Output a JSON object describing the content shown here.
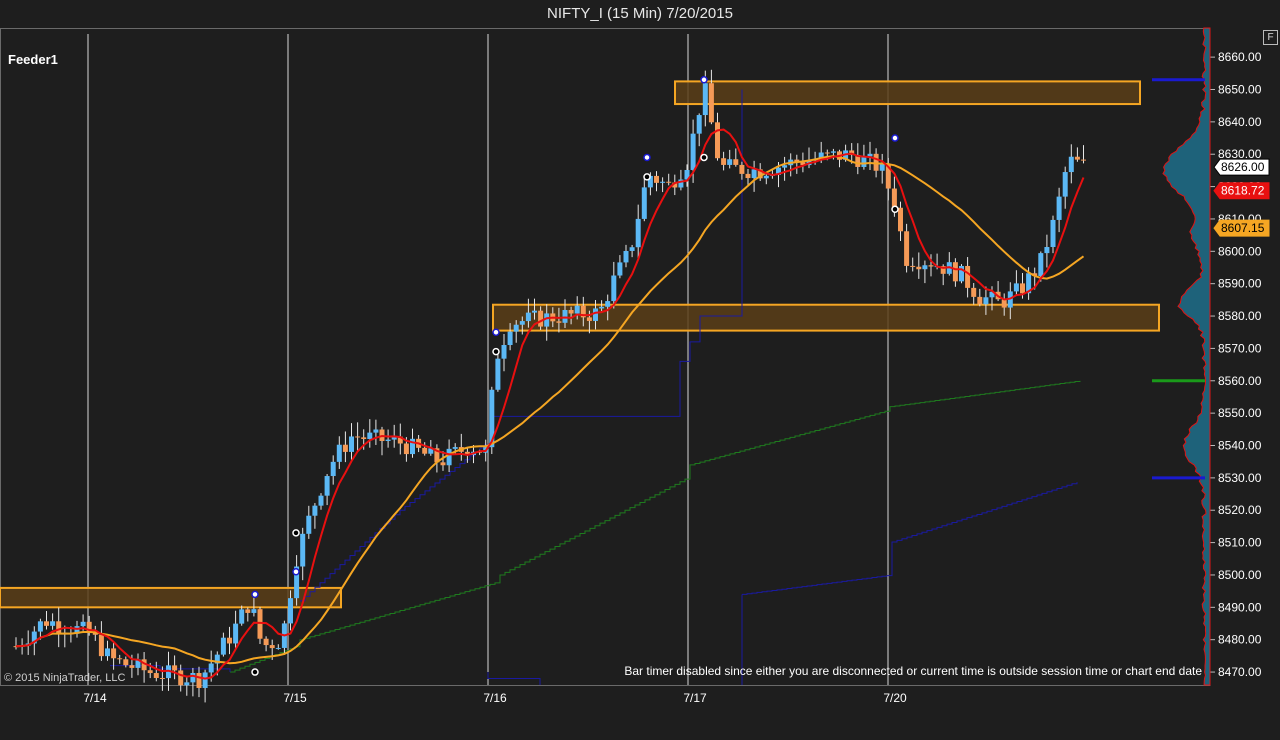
{
  "window": {
    "title": "NIFTY_I (15 Min)  7/20/2015",
    "panel_label": "Feeder1",
    "f_button": "F",
    "copyright": "© 2015 NinjaTrader, LLC",
    "bar_timer": "Bar timer disabled since either you are disconnected or current time is outside session time or chart end date"
  },
  "colors": {
    "background": "#1e1e1e",
    "up_candle": "#5bb8f5",
    "down_candle": "#f59a57",
    "fast_ma": "#e81010",
    "slow_ma": "#f5a623",
    "vwap_band": "#1e7a1e",
    "upper_band": "#1a1aa0",
    "zone_fill": "#5a3e17",
    "zone_border": "#f5a623",
    "profile": "#1f6f8b"
  },
  "chart_data": {
    "type": "candlestick",
    "ylim": [
      8466,
      8669
    ],
    "y_ticks": [
      "8660.00",
      "8650.00",
      "8640.00",
      "8630.00",
      "8620.00",
      "8610.00",
      "8600.00",
      "8590.00",
      "8580.00",
      "8570.00",
      "8560.00",
      "8550.00",
      "8540.00",
      "8530.00",
      "8520.00",
      "8510.00",
      "8500.00",
      "8490.00",
      "8480.00",
      "8470.00"
    ],
    "x_labels": [
      "7/14",
      "7/15",
      "7/16",
      "7/17",
      "7/20"
    ],
    "price_tags": [
      {
        "label": "8626.00",
        "value": 8626.0,
        "style": "last"
      },
      {
        "label": "8618.72",
        "value": 8618.72,
        "style": "fast"
      },
      {
        "label": "8607.15",
        "value": 8607.15,
        "style": "slow"
      }
    ],
    "zones": [
      {
        "name": "zone-top",
        "from": 8645.5,
        "to": 8652.5,
        "x_start": "7/17",
        "x_end": "7/20 end"
      },
      {
        "name": "zone-middle",
        "from": 8575.5,
        "to": 8583.5,
        "x_start": "7/16",
        "x_end": "7/20 end"
      },
      {
        "name": "zone-low",
        "from": 8490,
        "to": 8496,
        "x_start": "7/13",
        "x_end": "7/15"
      }
    ],
    "side_markers": [
      {
        "value": 8653,
        "color": "blue"
      },
      {
        "value": 8560,
        "color": "green"
      },
      {
        "value": 8530,
        "color": "blue"
      }
    ]
  }
}
